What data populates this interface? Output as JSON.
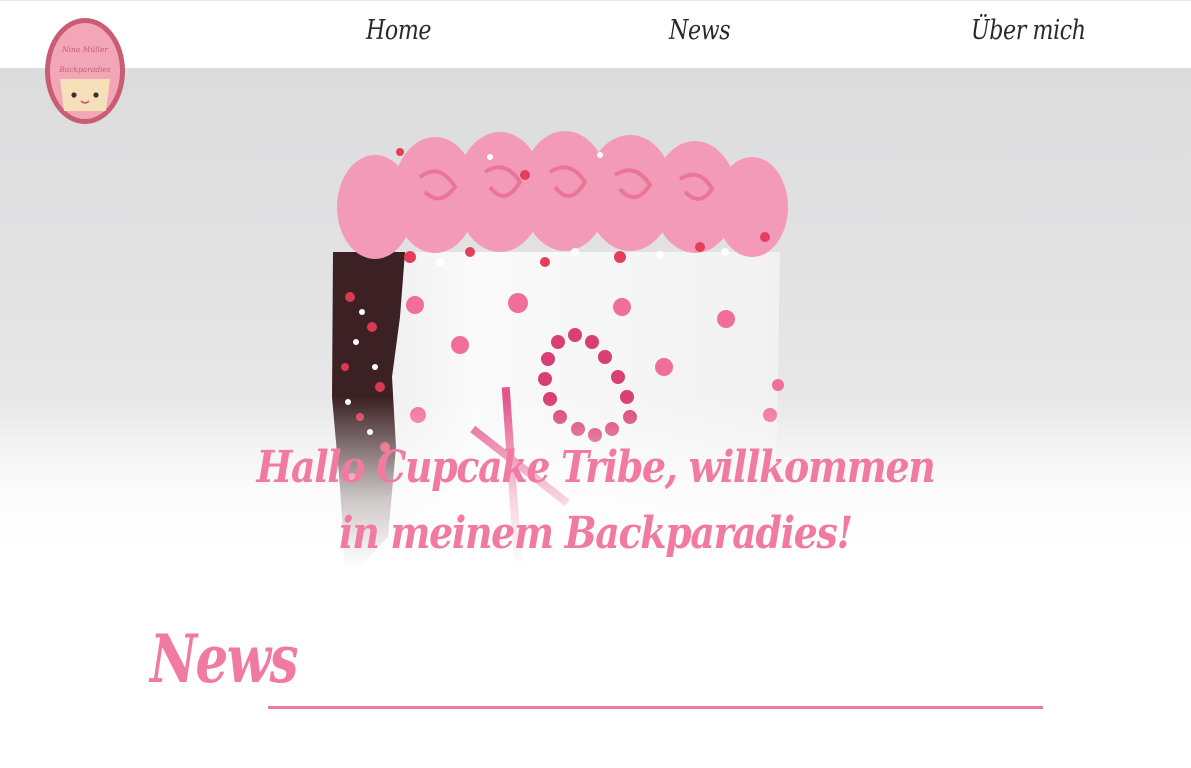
{
  "logo": {
    "line1": "Nina Müller",
    "line2": "Backparadies"
  },
  "nav": {
    "items": [
      {
        "label": "Home"
      },
      {
        "label": "News"
      },
      {
        "label": "Über mich"
      }
    ]
  },
  "hero": {
    "title_line1": "Hallo Cupcake Tribe, willkommen",
    "title_line2": "in meinem Backparadies!"
  },
  "news": {
    "heading": "News"
  },
  "colors": {
    "accent": "#f07aa2",
    "nav_text": "#2a2a2a",
    "frosting": "#f39ab8",
    "cake": "#fafafa"
  }
}
